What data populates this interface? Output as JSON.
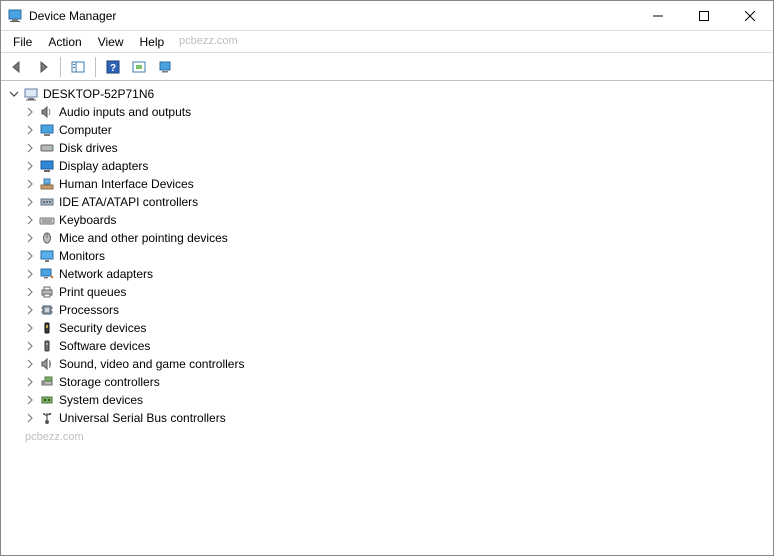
{
  "window": {
    "title": "Device Manager"
  },
  "menubar": {
    "file": "File",
    "action": "Action",
    "view": "View",
    "help": "Help"
  },
  "watermark": "pcbezz.com",
  "tree": {
    "root": {
      "label": "DESKTOP-52P71N6"
    },
    "items": [
      {
        "label": "Audio inputs and outputs",
        "icon": "speaker"
      },
      {
        "label": "Computer",
        "icon": "monitor"
      },
      {
        "label": "Disk drives",
        "icon": "disk"
      },
      {
        "label": "Display adapters",
        "icon": "display"
      },
      {
        "label": "Human Interface Devices",
        "icon": "hid"
      },
      {
        "label": "IDE ATA/ATAPI controllers",
        "icon": "ide"
      },
      {
        "label": "Keyboards",
        "icon": "keyboard"
      },
      {
        "label": "Mice and other pointing devices",
        "icon": "mouse"
      },
      {
        "label": "Monitors",
        "icon": "monitor2"
      },
      {
        "label": "Network adapters",
        "icon": "network"
      },
      {
        "label": "Print queues",
        "icon": "printer"
      },
      {
        "label": "Processors",
        "icon": "cpu"
      },
      {
        "label": "Security devices",
        "icon": "security"
      },
      {
        "label": "Software devices",
        "icon": "software"
      },
      {
        "label": "Sound, video and game controllers",
        "icon": "sound"
      },
      {
        "label": "Storage controllers",
        "icon": "storage"
      },
      {
        "label": "System devices",
        "icon": "system"
      },
      {
        "label": "Universal Serial Bus controllers",
        "icon": "usb"
      }
    ]
  }
}
